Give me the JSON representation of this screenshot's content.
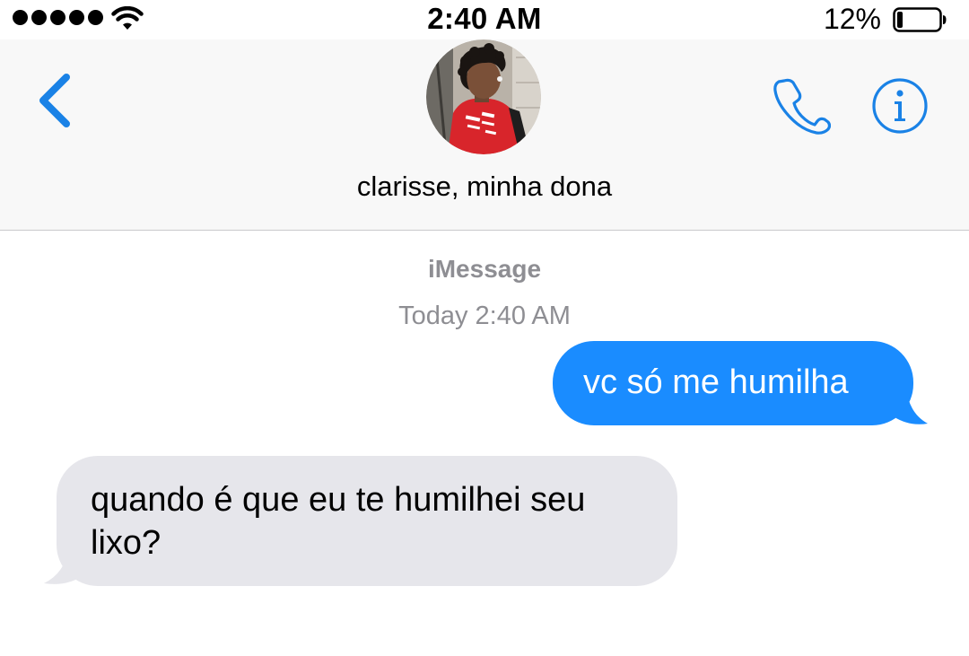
{
  "status_bar": {
    "time": "2:40 AM",
    "battery_percent": "12%",
    "battery_level": 0.12,
    "signal_bars": 5,
    "icons": [
      "signal-dots-icon",
      "wifi-icon",
      "battery-icon"
    ]
  },
  "header": {
    "contact_name": "clarisse, minha dona",
    "icons": [
      "back-chevron-icon",
      "phone-icon",
      "info-icon"
    ],
    "accent_color": "#1a82e6"
  },
  "conversation": {
    "service_label": "iMessage",
    "timestamp": "Today 2:40 AM",
    "messages": [
      {
        "direction": "sent",
        "text": "vc só me humilha"
      },
      {
        "direction": "received",
        "text": "quando é que eu te humilhei seu lixo?"
      }
    ],
    "sent_color": "#1a8cff",
    "received_color": "#e6e6eb"
  }
}
